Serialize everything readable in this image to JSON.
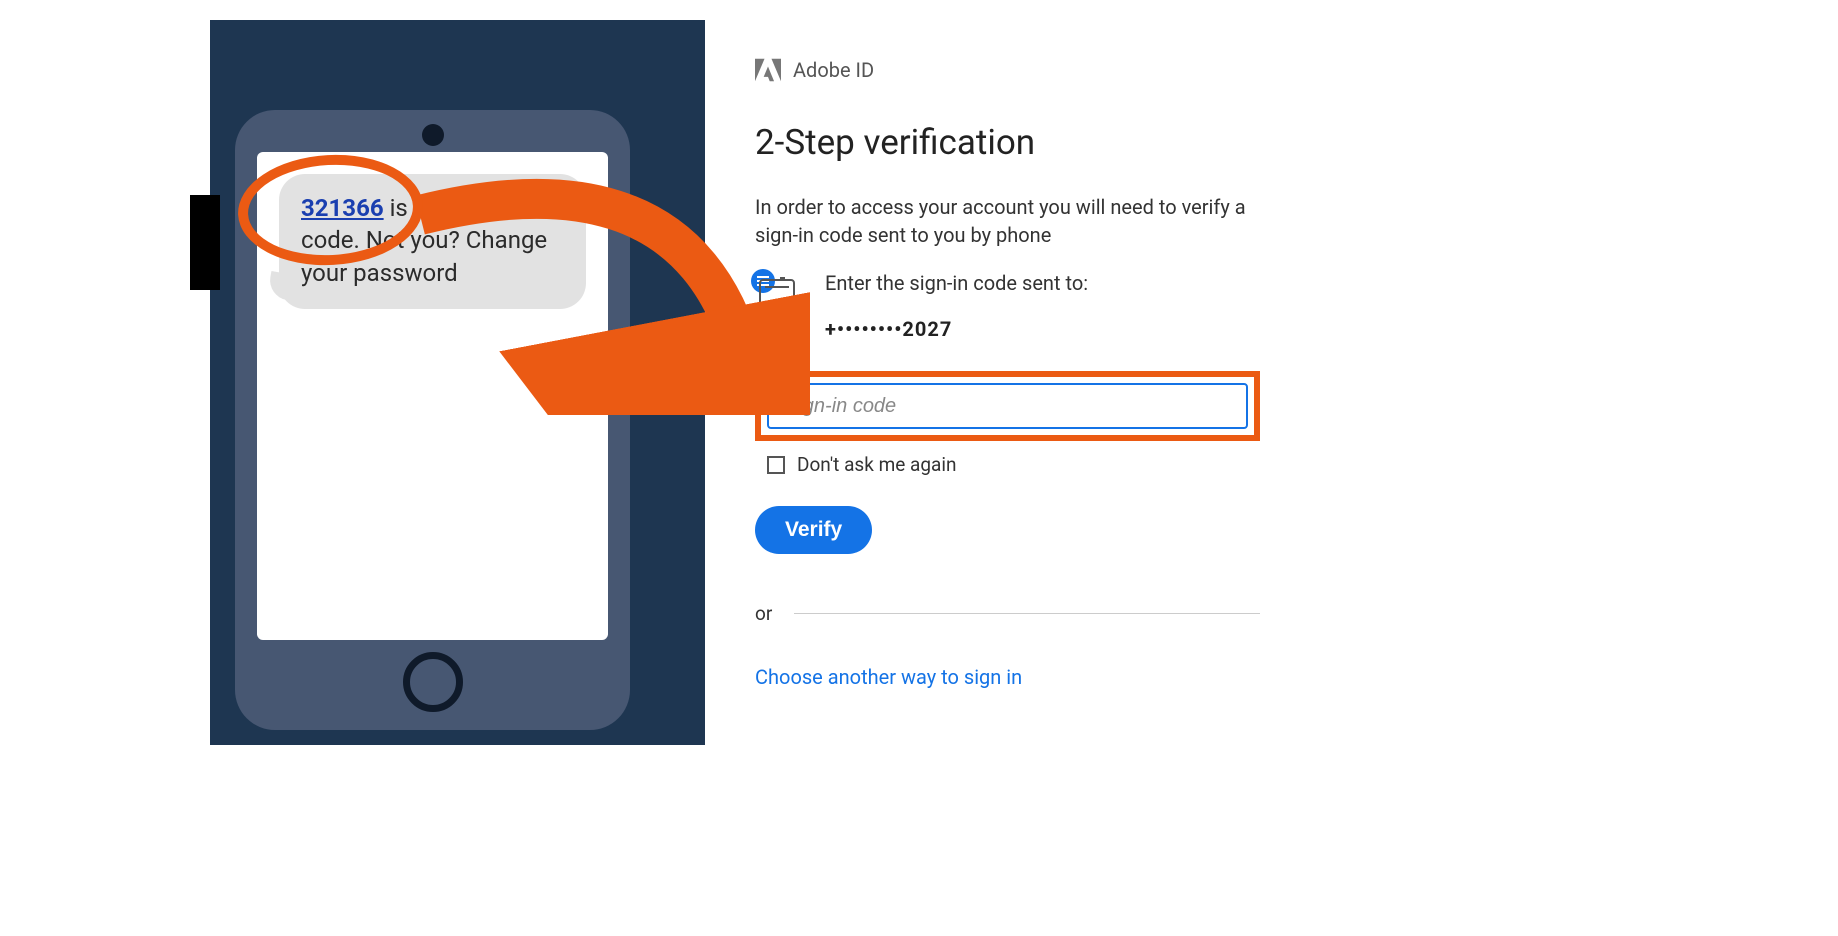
{
  "colors": {
    "accent_orange": "#eb5a13",
    "accent_blue": "#1473e6",
    "dark_bg": "#1e3651"
  },
  "phone": {
    "sms": {
      "code": "321366",
      "text_after_code": " is your Adobe code. Not you? Change your password"
    }
  },
  "panel": {
    "header_brand": "Adobe ID",
    "title": "2-Step verification",
    "description": "In order to access your account you will need to verify a sign-in code sent to you by phone",
    "enter_label": "Enter the sign-in code sent to:",
    "masked_number": "+••••••••2027",
    "input_placeholder": "Sign-in code",
    "checkbox_label": "Don't ask me again",
    "verify_label": "Verify",
    "or_label": "or",
    "alt_signin_label": "Choose another way to sign in"
  }
}
